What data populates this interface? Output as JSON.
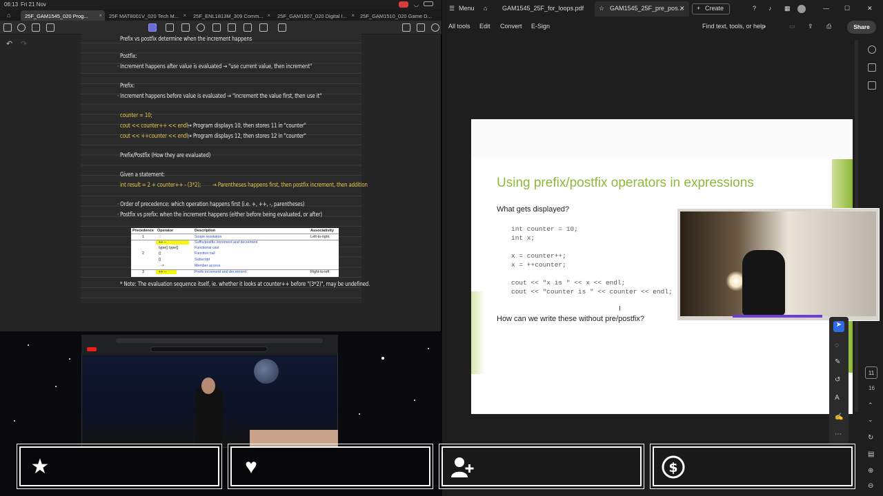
{
  "status": {
    "time": "06:13",
    "date": "Fri 21 Nov"
  },
  "notes_tabs": [
    {
      "label": "25F_GAM1545_020 Prog...",
      "active": true
    },
    {
      "label": "25F MAT8001V_020 Tech M...",
      "active": false
    },
    {
      "label": "25F_ENL1813M_309 Comm...",
      "active": false
    },
    {
      "label": "25F_GAM1507_020 Digital I...",
      "active": false
    },
    {
      "label": "25F_GAM1510_020 Game D...",
      "active": false
    }
  ],
  "notes": {
    "lines": [
      {
        "text": "Prefix vs postfix determine when the increment happens",
        "color": "white"
      },
      {
        "text": "Postfix:",
        "color": "white"
      },
      {
        "text": "· Increment happens after value is evaluated → \"use current value, then increment\"",
        "color": "white"
      },
      {
        "text": "Prefix:",
        "color": "white"
      },
      {
        "text": "· Increment happens before value is evaluated → \"increment the value first, then use it\"",
        "color": "white"
      },
      {
        "text": "counter = 10;",
        "color": "yellow"
      },
      {
        "text": "cout << counter++ << endl;",
        "color": "yellow"
      },
      {
        "text": "→ Program displays 10, then stores 11 in \"counter\"",
        "color": "white"
      },
      {
        "text": "cout << ++counter << endl;",
        "color": "yellow"
      },
      {
        "text": "→ Program displays 12, then stores 12 in \"counter\"",
        "color": "white"
      },
      {
        "text": "Prefix/Postfix (How they are evaluated)",
        "color": "white"
      },
      {
        "text": "Given a statement:",
        "color": "white"
      },
      {
        "text": "int result = 2 + counter++ - (3*2);",
        "color": "yellow"
      },
      {
        "text": "→ Parentheses happens first, then postfix increment, then addition",
        "color": "yellow"
      },
      {
        "text": "· Order of precedence: which operation happens first (i.e. +, ++, -, parentheses)",
        "color": "white"
      },
      {
        "text": "· Postfix vs prefix: when the increment happens (either before being evaluated, or after)",
        "color": "white"
      },
      {
        "text": "* Note: The evaluation sequence itself, ie. whether it looks at counter++ before \"(3*2)\", may be undefined.",
        "color": "white"
      }
    ],
    "table": {
      "headers": [
        "Precedence",
        "Operator",
        "Description",
        "Associativity"
      ],
      "rows": [
        {
          "prec": "1",
          "op": "::",
          "desc": "Scope resolution",
          "assoc": "Left-to-right"
        },
        {
          "prec": "",
          "op": "++   --",
          "desc": "Suffix/postfix increment and decrement",
          "assoc": ""
        },
        {
          "prec": "",
          "op": "type()   type{}",
          "desc": "Functional cast",
          "assoc": ""
        },
        {
          "prec": "2",
          "op": "()",
          "desc": "Function call",
          "assoc": ""
        },
        {
          "prec": "",
          "op": "[]",
          "desc": "Subscript",
          "assoc": ""
        },
        {
          "prec": "",
          "op": ".   ->",
          "desc": "Member access",
          "assoc": ""
        },
        {
          "prec": "3",
          "op": "++   --",
          "desc": "Prefix increment and decrement",
          "assoc": "Right-to-left"
        }
      ]
    }
  },
  "acrobat": {
    "menu_label": "Menu",
    "tabs": [
      {
        "label": "GAM1545_25F_for_loops.pdf",
        "active": false
      },
      {
        "label": "GAM1545_25F_pre_pos...",
        "active": true
      }
    ],
    "create_label": "Create",
    "menu_items": [
      "All tools",
      "Edit",
      "Convert",
      "E-Sign"
    ],
    "find_label": "Find text, tools, or help",
    "share_label": "Share",
    "page_current": "11",
    "page_total": "16"
  },
  "slide": {
    "title": "Using prefix/postfix operators in expressions",
    "question1": "What gets displayed?",
    "code": [
      "int counter = 10;",
      "int x;",
      "",
      "x = counter++;",
      "x = ++counter;",
      "",
      "cout << \"x is \" << x << endl;",
      "cout << \"counter is \" << counter << endl;"
    ],
    "question2": "How can we write these without pre/postfix?"
  },
  "overlay": {
    "icons": [
      "star-icon",
      "heart-icon",
      "user-plus-icon",
      "dollar-icon"
    ]
  },
  "colors": {
    "accent": "#8fb838",
    "note_yellow": "#e3c64a",
    "highlight": "#f5f518"
  }
}
